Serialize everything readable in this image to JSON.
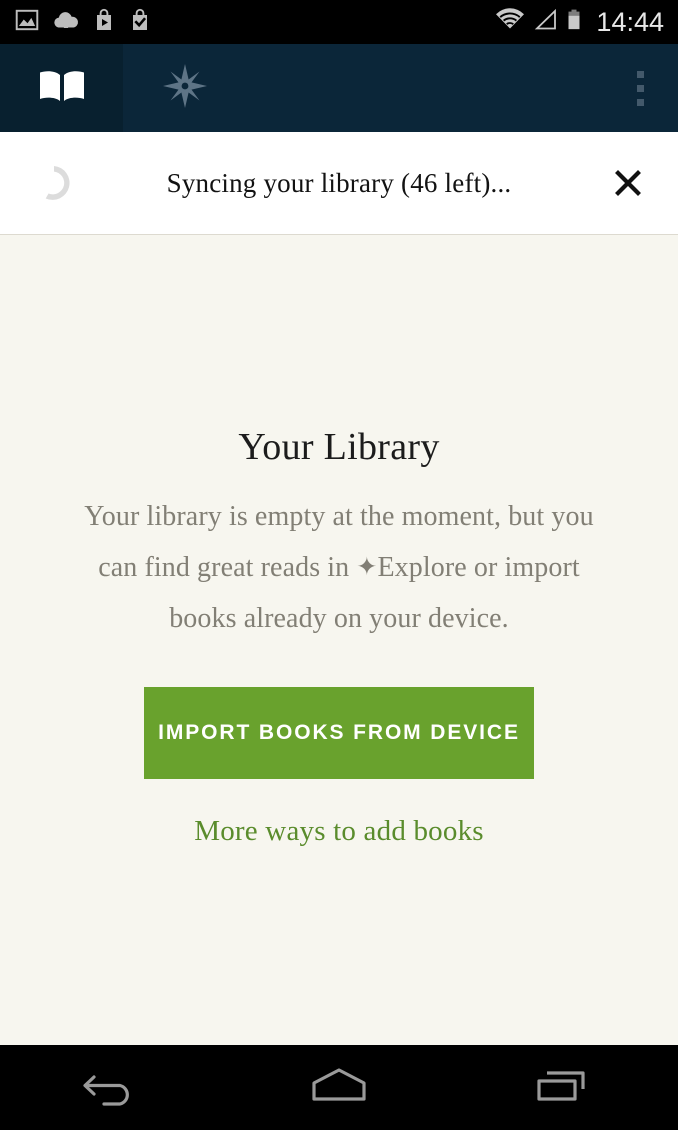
{
  "status_bar": {
    "clock": "14:44",
    "left_icons": [
      {
        "name": "screenshot-image-icon"
      },
      {
        "name": "cloud-upload-icon"
      },
      {
        "name": "play-store-bag-icon"
      },
      {
        "name": "app-installed-bag-check-icon"
      }
    ],
    "right_icons": [
      {
        "name": "wifi-icon"
      },
      {
        "name": "cellular-signal-icon"
      },
      {
        "name": "battery-icon"
      }
    ],
    "background_color": "#000000",
    "text_color": "#e8e8e8"
  },
  "toolbar": {
    "background_color": "#0b2639",
    "active_tab_color": "#08202f",
    "tabs": [
      {
        "name": "tab-library",
        "icon": "open-book-icon",
        "active": true
      },
      {
        "name": "tab-explore",
        "icon": "compass-star-icon",
        "active": false
      }
    ],
    "overflow_menu": {
      "icon": "overflow-menu-icon",
      "label": "More options",
      "dot_color": "#43596b"
    }
  },
  "sync_bar": {
    "message": "Syncing your library (46 left)...",
    "remaining": 46,
    "spinner_icon": "loading-spinner-icon",
    "close_icon": "close-icon",
    "background_color": "#ffffff",
    "text_color": "#121212"
  },
  "empty_state": {
    "title": "Your Library",
    "description_line1": "Your library is empty at the moment, but",
    "description_line2_prefix": "you can find great reads in",
    "explore_glyph": "✦",
    "description_line2_suffix": "Explore or",
    "description_line3": "import books already on your device.",
    "import_button_label": "IMPORT BOOKS FROM DEVICE",
    "more_ways_label": "More ways to add books",
    "accent_green": "#69a22d",
    "link_green": "#5a8c2c",
    "background_color": "#f7f6ef",
    "body_text_color": "#827f75"
  },
  "nav_bar": {
    "background_color": "#000000",
    "buttons": [
      {
        "name": "nav-back-button",
        "icon": "back-arrow-icon"
      },
      {
        "name": "nav-home-button",
        "icon": "home-icon"
      },
      {
        "name": "nav-recents-button",
        "icon": "recents-icon"
      }
    ]
  }
}
